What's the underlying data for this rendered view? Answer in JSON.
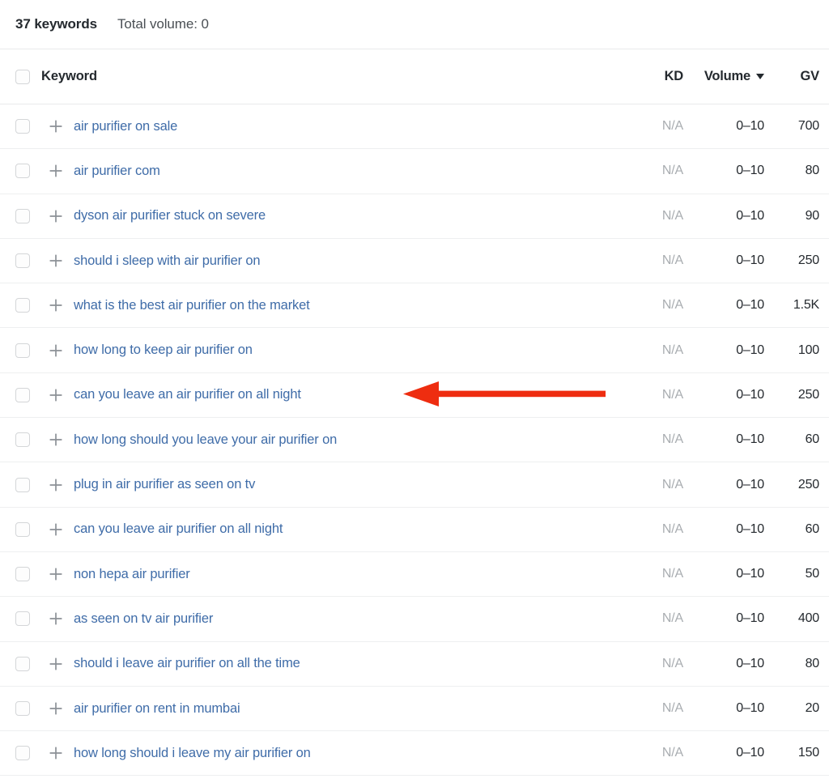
{
  "summary": {
    "count_label": "37 keywords",
    "total_volume_label": "Total volume: 0"
  },
  "table": {
    "headers": {
      "keyword": "Keyword",
      "kd": "KD",
      "volume": "Volume",
      "gv": "GV"
    },
    "sort": {
      "column": "Volume",
      "direction": "desc",
      "icon": "caret-down-icon"
    },
    "select_all_checked": false,
    "rows": [
      {
        "keyword": "air purifier on sale",
        "kd": "N/A",
        "volume": "0–10",
        "gv": "700",
        "checked": false
      },
      {
        "keyword": "air purifier com",
        "kd": "N/A",
        "volume": "0–10",
        "gv": "80",
        "checked": false
      },
      {
        "keyword": "dyson air purifier stuck on severe",
        "kd": "N/A",
        "volume": "0–10",
        "gv": "90",
        "checked": false
      },
      {
        "keyword": "should i sleep with air purifier on",
        "kd": "N/A",
        "volume": "0–10",
        "gv": "250",
        "checked": false
      },
      {
        "keyword": "what is the best air purifier on the market",
        "kd": "N/A",
        "volume": "0–10",
        "gv": "1.5K",
        "checked": false
      },
      {
        "keyword": "how long to keep air purifier on",
        "kd": "N/A",
        "volume": "0–10",
        "gv": "100",
        "checked": false
      },
      {
        "keyword": "can you leave an air purifier on all night",
        "kd": "N/A",
        "volume": "0–10",
        "gv": "250",
        "checked": false
      },
      {
        "keyword": "how long should you leave your air purifier on",
        "kd": "N/A",
        "volume": "0–10",
        "gv": "60",
        "checked": false
      },
      {
        "keyword": "plug in air purifier as seen on tv",
        "kd": "N/A",
        "volume": "0–10",
        "gv": "250",
        "checked": false
      },
      {
        "keyword": "can you leave air purifier on all night",
        "kd": "N/A",
        "volume": "0–10",
        "gv": "60",
        "checked": false
      },
      {
        "keyword": "non hepa air purifier",
        "kd": "N/A",
        "volume": "0–10",
        "gv": "50",
        "checked": false
      },
      {
        "keyword": "as seen on tv air purifier",
        "kd": "N/A",
        "volume": "0–10",
        "gv": "400",
        "checked": false
      },
      {
        "keyword": "should i leave air purifier on all the time",
        "kd": "N/A",
        "volume": "0–10",
        "gv": "80",
        "checked": false
      },
      {
        "keyword": "air purifier on rent in mumbai",
        "kd": "N/A",
        "volume": "0–10",
        "gv": "20",
        "checked": false
      },
      {
        "keyword": "how long should i leave my air purifier on",
        "kd": "N/A",
        "volume": "0–10",
        "gv": "150",
        "checked": false
      }
    ]
  },
  "annotation": {
    "type": "arrow-left",
    "color": "#ee2d10",
    "points_at_row_index": 6,
    "points_at_keyword": "can you leave an air purifier on all night"
  },
  "colors": {
    "link": "#3f6ca8",
    "text": "#24292e",
    "muted": "#a9adb1",
    "divider": "#eeeff0",
    "annotation": "#ee2d10"
  }
}
